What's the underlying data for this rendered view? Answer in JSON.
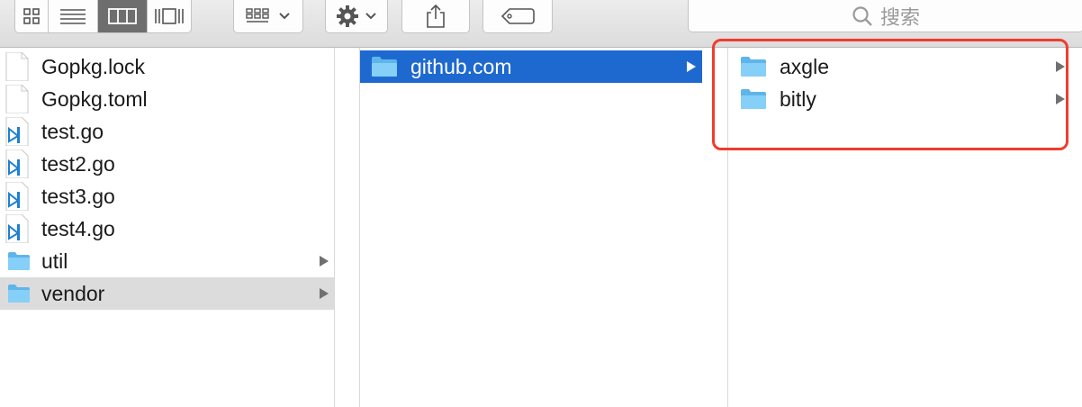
{
  "toolbar": {
    "view_modes": [
      {
        "icon": "icon-view-icon",
        "active": false
      },
      {
        "icon": "list-view-icon",
        "active": false
      },
      {
        "icon": "column-view-icon",
        "active": true
      },
      {
        "icon": "gallery-view-icon",
        "active": false
      }
    ],
    "arrange_icon": "arrange-icon",
    "action_icon": "gear-icon",
    "share_icon": "share-icon",
    "tag_icon": "tag-icon",
    "search": {
      "placeholder": "搜索",
      "icon": "search-icon"
    }
  },
  "columns": [
    {
      "items": [
        {
          "name": "Gopkg.lock",
          "icon": "document-icon",
          "kind": "file"
        },
        {
          "name": "Gopkg.toml",
          "icon": "document-icon",
          "kind": "file"
        },
        {
          "name": "test.go",
          "icon": "vscode-file-icon",
          "kind": "file"
        },
        {
          "name": "test2.go",
          "icon": "vscode-file-icon",
          "kind": "file"
        },
        {
          "name": "test3.go",
          "icon": "vscode-file-icon",
          "kind": "file"
        },
        {
          "name": "test4.go",
          "icon": "vscode-file-icon",
          "kind": "file"
        },
        {
          "name": "util",
          "icon": "folder-icon",
          "kind": "folder"
        },
        {
          "name": "vendor",
          "icon": "folder-icon",
          "kind": "folder",
          "selected": "inactive"
        }
      ]
    },
    {
      "items": [
        {
          "name": "github.com",
          "icon": "folder-icon",
          "kind": "folder",
          "selected": "active"
        }
      ]
    },
    {
      "items": [
        {
          "name": "axgle",
          "icon": "folder-icon",
          "kind": "folder"
        },
        {
          "name": "bitly",
          "icon": "folder-icon",
          "kind": "folder"
        }
      ]
    }
  ],
  "colors": {
    "selection_active": "#1e69d0",
    "selection_inactive": "#dcdcdc",
    "folder": "#6cc3f5",
    "annotation": "#f03c2e"
  }
}
